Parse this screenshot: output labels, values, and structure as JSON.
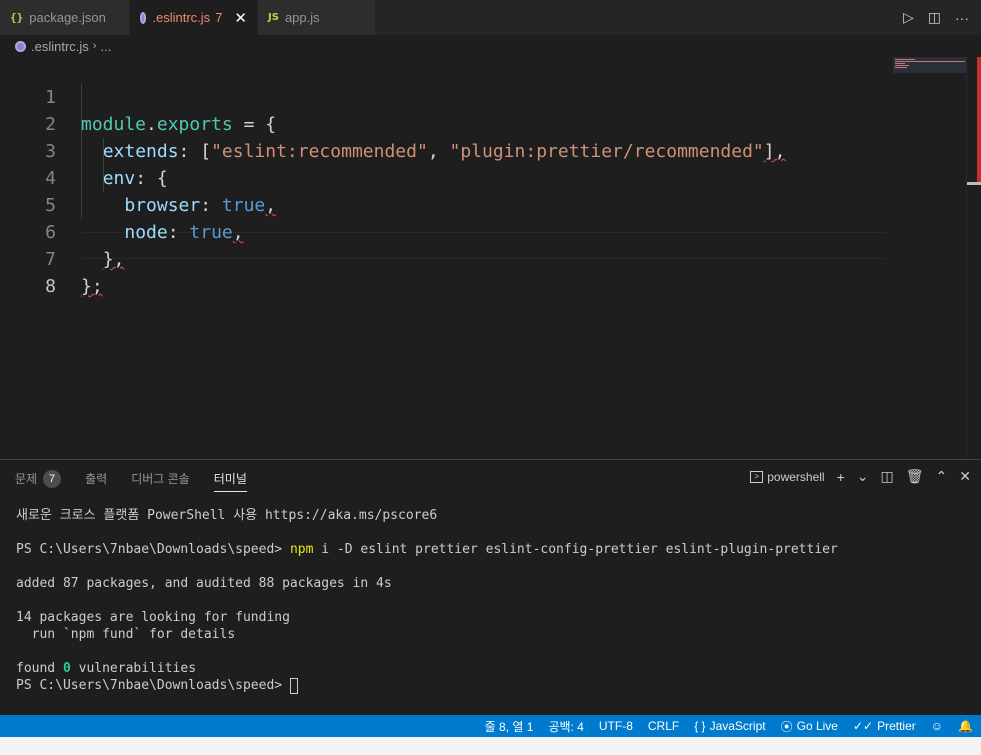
{
  "tabs": [
    {
      "icon": "{}",
      "label": "package.json",
      "active": false
    },
    {
      "icon": "eslint",
      "label": ".eslintrc.js",
      "badge": "7",
      "active": true
    },
    {
      "icon": "JS",
      "label": "app.js",
      "active": false
    }
  ],
  "tab_actions": {
    "run": "▷",
    "split": "◫",
    "more": "···"
  },
  "breadcrumb": {
    "file": ".eslintrc.js",
    "rest": "..."
  },
  "editor": {
    "line_numbers": [
      "1",
      "2",
      "3",
      "4",
      "5",
      "6",
      "7",
      "8"
    ],
    "current_line": "8",
    "lines": {
      "l1": {
        "a": "module",
        "b": ".",
        "c": "exports",
        "d": " = {"
      },
      "l2": {
        "prop": "extends",
        "colon": ": [",
        "s1": "\"eslint:recommended\"",
        "comma": ", ",
        "s2": "\"plugin:prettier/recommended\"",
        "end": "],"
      },
      "l3": {
        "prop": "env",
        "rest": ": {"
      },
      "l4": {
        "prop": "browser",
        "colon": ": ",
        "val": "true",
        "end": ","
      },
      "l5": {
        "prop": "node",
        "colon": ": ",
        "val": "true",
        "end": ","
      },
      "l6": {
        "text": "},"
      },
      "l7": {
        "text": "};"
      }
    }
  },
  "panel": {
    "tabs": [
      {
        "label": "문제",
        "badge": "7"
      },
      {
        "label": "출력"
      },
      {
        "label": "디버그 콘솔"
      },
      {
        "label": "터미널",
        "active": true
      }
    ],
    "shell": "powershell",
    "actions": {
      "add": "+",
      "dropdown": "⌄",
      "split": "◫",
      "trash": "🗑",
      "maximize": "⌃",
      "close": "✕"
    }
  },
  "terminal": {
    "l1": "새로운 크로스 플랫폼 PowerShell 사용 https://aka.ms/pscore6",
    "l2_prompt": "PS C:\\Users\\7nbae\\Downloads\\speed> ",
    "l2_cmd": "npm",
    "l2_i": " i ",
    "l2_flag": "-D",
    "l2_rest": " eslint prettier eslint-config-prettier eslint-plugin-prettier",
    "l3": "added 87 packages, and audited 88 packages in 4s",
    "l4": "14 packages are looking for funding",
    "l5": "  run `npm fund` for details",
    "l6_a": "found ",
    "l6_num": "0",
    "l6_b": " vulnerabilities",
    "l7": "PS C:\\Users\\7nbae\\Downloads\\speed> "
  },
  "status": {
    "position": "줄 8, 열 1",
    "spaces": "공백: 4",
    "encoding": "UTF-8",
    "eol": "CRLF",
    "language_icon": "{ }",
    "language": "JavaScript",
    "golive": "Go Live",
    "prettier": "Prettier"
  },
  "colors": {
    "accent": "#007acc",
    "error": "#f14c4c",
    "active_tab_text": "#f48771"
  }
}
